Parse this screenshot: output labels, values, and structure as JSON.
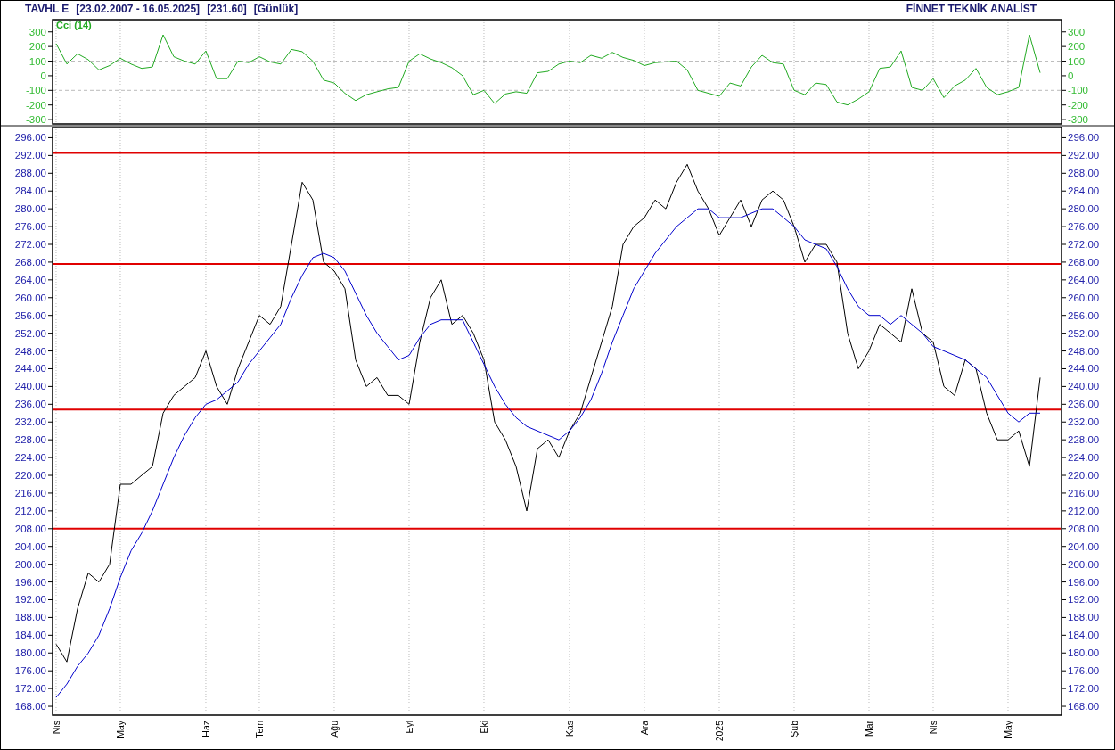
{
  "header": {
    "symbol": "TAVHL E",
    "date_range": "[23.02.2007 - 16.05.2025]",
    "last_price": "[231.60]",
    "period": "[Günlük]",
    "brand": "FİNNET TEKNİK ANALİST"
  },
  "cci_panel": {
    "chart_data": {
      "type": "line",
      "title": "Cci (14)",
      "grid": true,
      "ylim": [
        -330,
        384
      ],
      "y2lim": [
        -330,
        384
      ],
      "yticks": [
        300,
        200,
        100,
        0,
        -100,
        -200,
        -300
      ],
      "y2ticks": [
        300,
        200,
        100,
        0,
        -100,
        -200,
        -300
      ],
      "series": [
        {
          "color": "#22aa22",
          "values": [
            220,
            80,
            150,
            110,
            40,
            70,
            120,
            80,
            50,
            60,
            280,
            130,
            100,
            80,
            170,
            -20,
            -20,
            100,
            90,
            130,
            95,
            80,
            180,
            165,
            100,
            -30,
            -50,
            -120,
            -170,
            -130,
            -110,
            -90,
            -80,
            100,
            150,
            115,
            90,
            55,
            0,
            -130,
            -100,
            -190,
            -125,
            -110,
            -120,
            20,
            30,
            80,
            100,
            90,
            140,
            120,
            160,
            125,
            105,
            70,
            90,
            95,
            100,
            40,
            -100,
            -120,
            -140,
            -50,
            -70,
            60,
            140,
            90,
            80,
            -100,
            -130,
            -50,
            -60,
            -180,
            -200,
            -160,
            -110,
            50,
            60,
            170,
            -80,
            -100,
            -20,
            -150,
            -70,
            -30,
            50,
            -80,
            -130,
            -110,
            -80,
            280,
            20
          ]
        }
      ]
    }
  },
  "price_panel": {
    "chart_data": {
      "type": "line",
      "grid": true,
      "ylim": [
        166,
        298.5
      ],
      "y2lim": [
        166,
        298.5
      ],
      "categories": [
        "Nis",
        null,
        null,
        null,
        null,
        null,
        "May",
        null,
        null,
        null,
        null,
        null,
        null,
        null,
        "Haz",
        null,
        null,
        null,
        null,
        "Tem",
        null,
        null,
        null,
        null,
        null,
        null,
        "Ağu",
        null,
        null,
        null,
        null,
        null,
        null,
        "Eyl",
        null,
        null,
        null,
        null,
        null,
        null,
        "Eki",
        null,
        null,
        null,
        null,
        null,
        null,
        null,
        "Kas",
        null,
        null,
        null,
        null,
        null,
        null,
        "Ara",
        null,
        null,
        null,
        null,
        null,
        null,
        "2025",
        null,
        null,
        null,
        null,
        null,
        null,
        "Şub",
        null,
        null,
        null,
        null,
        null,
        null,
        "Mar",
        null,
        null,
        null,
        null,
        null,
        "Nis",
        null,
        null,
        null,
        null,
        null,
        null,
        "May",
        null,
        null,
        null
      ],
      "yticks": [
        {
          "value": 296,
          "label": "296.00"
        },
        {
          "value": 292,
          "label": "292.00"
        },
        {
          "value": 288,
          "label": "288.00"
        },
        {
          "value": 284,
          "label": "284.00"
        },
        {
          "value": 280,
          "label": "280.00"
        },
        {
          "value": 276,
          "label": "276.00"
        },
        {
          "value": 272,
          "label": "272.00"
        },
        {
          "value": 268,
          "label": "268.00"
        },
        {
          "value": 264,
          "label": "264.00"
        },
        {
          "value": 260,
          "label": "260.00"
        },
        {
          "value": 256,
          "label": "256.00"
        },
        {
          "value": 252,
          "label": "252.00"
        },
        {
          "value": 248,
          "label": "248.00"
        },
        {
          "value": 244,
          "label": "244.00"
        },
        {
          "value": 240,
          "label": "240.00"
        },
        {
          "value": 236,
          "label": "236.00"
        },
        {
          "value": 232,
          "label": "232.00"
        },
        {
          "value": 228,
          "label": "228.00"
        },
        {
          "value": 224,
          "label": "224.00"
        },
        {
          "value": 220,
          "label": "220.00"
        },
        {
          "value": 216,
          "label": "216.00"
        },
        {
          "value": 212,
          "label": "212.00"
        },
        {
          "value": 208,
          "label": "208.00"
        },
        {
          "value": 204,
          "label": "204.00"
        },
        {
          "value": 200,
          "label": "200.00"
        },
        {
          "value": 196,
          "label": "196.00"
        },
        {
          "value": 192,
          "label": "192.00"
        },
        {
          "value": 188,
          "label": "188.00"
        },
        {
          "value": 184,
          "label": "184.00"
        },
        {
          "value": 180,
          "label": "180.00"
        },
        {
          "value": 176,
          "label": "176.00"
        },
        {
          "value": 172,
          "label": "172.00"
        },
        {
          "value": 168,
          "label": "168.00"
        }
      ],
      "y2ticks": [
        {
          "value": 296,
          "label": "296.00"
        },
        {
          "value": 292,
          "label": "292.00"
        },
        {
          "value": 288,
          "label": "288.00"
        },
        {
          "value": 284,
          "label": "284.00"
        },
        {
          "value": 280,
          "label": "280.00"
        },
        {
          "value": 276,
          "label": "276.00"
        },
        {
          "value": 272,
          "label": "272.00"
        },
        {
          "value": 268,
          "label": "268.00"
        },
        {
          "value": 264,
          "label": "264.00"
        },
        {
          "value": 260,
          "label": "260.00"
        },
        {
          "value": 256,
          "label": "256.00"
        },
        {
          "value": 252,
          "label": "252.00"
        },
        {
          "value": 248,
          "label": "248.00"
        },
        {
          "value": 244,
          "label": "244.00"
        },
        {
          "value": 240,
          "label": "240.00"
        },
        {
          "value": 236,
          "label": "236.00"
        },
        {
          "value": 232,
          "label": "232.00"
        },
        {
          "value": 228,
          "label": "228.00"
        },
        {
          "value": 224,
          "label": "224.00"
        },
        {
          "value": 220,
          "label": "220.00"
        },
        {
          "value": 216,
          "label": "216.00"
        },
        {
          "value": 212,
          "label": "212.00"
        },
        {
          "value": 208,
          "label": "208.00"
        },
        {
          "value": 204,
          "label": "204.00"
        },
        {
          "value": 200,
          "label": "200.00"
        },
        {
          "value": 196,
          "label": "196.00"
        },
        {
          "value": 192,
          "label": "192.00"
        },
        {
          "value": 188,
          "label": "188.00"
        },
        {
          "value": 184,
          "label": "184.00"
        },
        {
          "value": 180,
          "label": "180.00"
        },
        {
          "value": 176,
          "label": "176.00"
        },
        {
          "value": 172,
          "label": "172.00"
        },
        {
          "value": 168,
          "label": "168.00"
        }
      ],
      "series": [
        {
          "color": "#000000",
          "values": [
            182,
            178,
            190,
            198,
            196,
            200,
            218,
            218,
            220,
            222,
            234,
            238,
            240,
            242,
            248,
            240,
            236,
            244,
            250,
            256,
            254,
            258,
            272,
            286,
            282,
            268,
            266,
            262,
            246,
            240,
            242,
            238,
            238,
            236,
            250,
            260,
            264,
            254,
            256,
            252,
            246,
            232,
            228,
            222,
            212,
            226,
            228,
            224,
            230,
            234,
            242,
            250,
            258,
            272,
            276,
            278,
            282,
            280,
            286,
            290,
            284,
            280,
            274,
            278,
            282,
            276,
            282,
            284,
            282,
            276,
            268,
            272,
            272,
            268,
            252,
            244,
            248,
            254,
            252,
            250,
            262,
            252,
            250,
            240,
            238,
            246,
            244,
            234,
            228,
            228,
            230,
            222,
            242
          ]
        },
        {
          "color": "#0000cc",
          "values": [
            170,
            173,
            177,
            180,
            184,
            190,
            197,
            203,
            207,
            212,
            218,
            224,
            229,
            233,
            236,
            237,
            239,
            241,
            245,
            248,
            251,
            254,
            260,
            265,
            269,
            270,
            269,
            266,
            261,
            256,
            252,
            249,
            246,
            247,
            251,
            254,
            255,
            255,
            255,
            250,
            245,
            240,
            236,
            233,
            231,
            230,
            229,
            228,
            230,
            233,
            237,
            243,
            250,
            256,
            262,
            266,
            270,
            273,
            276,
            278,
            280,
            280,
            278,
            278,
            278,
            279,
            280,
            280,
            278,
            276,
            273,
            272,
            271,
            267,
            262,
            258,
            256,
            256,
            254,
            256,
            254,
            252,
            249,
            248,
            247,
            246,
            244,
            242,
            238,
            234,
            232,
            234,
            234
          ]
        }
      ],
      "ref_lines": [
        {
          "axis": "y",
          "value": 292.6
        },
        {
          "axis": "y",
          "value": 267.6
        },
        {
          "axis": "y",
          "value": 234.8
        },
        {
          "axis": "y",
          "value": 208
        }
      ]
    }
  }
}
